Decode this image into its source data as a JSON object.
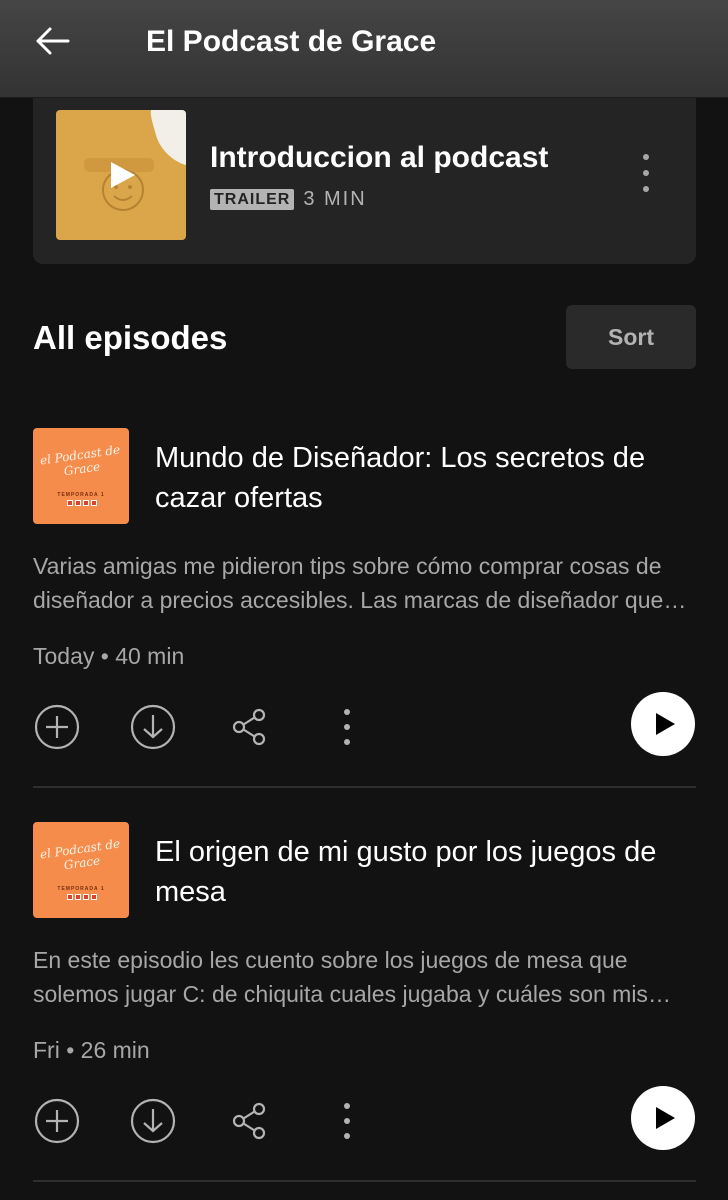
{
  "header": {
    "title": "El Podcast de Grace"
  },
  "trailer": {
    "title": "Introduccion al podcast",
    "badge": "TRAILER",
    "duration": "3 MIN"
  },
  "episodes_section": {
    "title": "All episodes",
    "sort_label": "Sort"
  },
  "episodes": [
    {
      "title": "Mundo de Diseñador: Los secretos de cazar ofertas",
      "description": "Varias amigas me pidieron tips sobre cómo comprar cosas de diseñador a precios accesibles. Las marcas de diseñador que más me gustan y dónde las encuentro.",
      "meta": "Today • 40 min",
      "art": {
        "title": "el Podcast de Grace",
        "subtitle": "TEMPORADA 1"
      }
    },
    {
      "title": "El origen de mi gusto por los juegos de mesa",
      "description": "En este episodio les cuento sobre los juegos de mesa que solemos jugar C: de chiquita cuales jugaba y cuáles son mis favoritos hoy en día.",
      "meta": "Fri • 26 min",
      "art": {
        "title": "el Podcast de Grace",
        "subtitle": "TEMPORADA 1"
      }
    }
  ],
  "colors": {
    "background": "#121212",
    "card": "#242424",
    "accent_art": "#f58c4b",
    "trailer_art": "#dba64a"
  }
}
